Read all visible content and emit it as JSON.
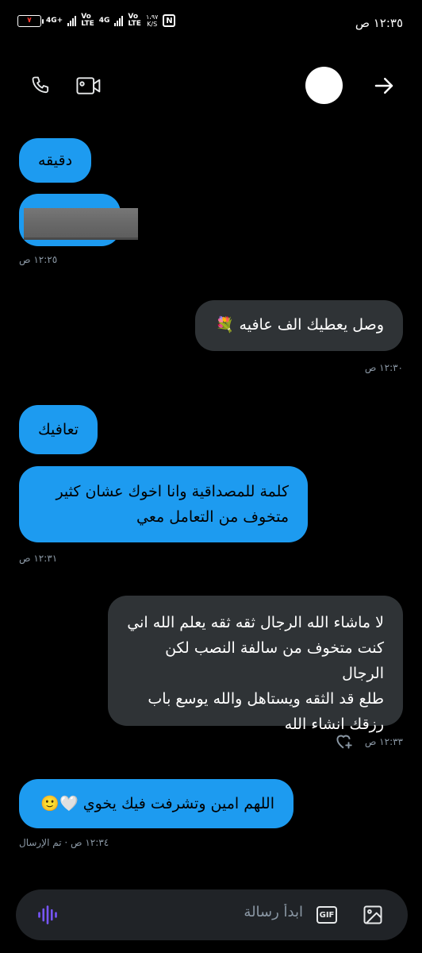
{
  "status_bar": {
    "time": "١٢:٣٥ ص",
    "battery": "٧",
    "net1": "4G+",
    "net1_sub": "",
    "volte1": "Vo\nLTE",
    "net2": "4G",
    "volte2": "Vo\nLTE",
    "speed": "١،٩٧\nK/S",
    "nfc": "N"
  },
  "header": {
    "call_icon": "phone-icon",
    "video_icon": "video-camera-icon",
    "back_icon": "arrow-right-icon"
  },
  "messages": [
    {
      "side": "received",
      "text": "دقيقه"
    },
    {
      "side": "received",
      "text": "",
      "redacted": true
    },
    {
      "meta": "١٢:٢٥ ص"
    },
    {
      "side": "sent",
      "text": "وصل يعطيك الف عافيه 💐"
    },
    {
      "meta": "١٢:٣٠ ص"
    },
    {
      "side": "received",
      "text": "تعافيك"
    },
    {
      "side": "received",
      "line1": "كلمة للمصداقية وانا اخوك عشان كثير",
      "line2": "متخوف من التعامل معي"
    },
    {
      "meta": "١٢:٣١ ص"
    },
    {
      "side": "sent",
      "line1": "لا ماشاء الله الرجال ثقه ثقه يعلم الله اني",
      "line2": "كنت متخوف من سالفة النصب لكن الرجال",
      "line3": "طلع قد الثقه ويستاهل والله يوسع باب",
      "line4": "رزقك انشاء الله"
    },
    {
      "meta": "١٢:٣٣ ص"
    },
    {
      "side": "received",
      "text": "اللهم امين وتشرفت فيك يخوي 🤍🙂"
    },
    {
      "meta": "١٢:٣٤ ص · تم الإرسال"
    }
  ],
  "composer": {
    "placeholder": "ابدأ رسالة",
    "gif_label": "GIF",
    "image_icon": "image-icon",
    "voice_icon": "voice-wave-icon"
  },
  "colors": {
    "received_bubble": "#1d9bf0",
    "sent_bubble": "#2f3336",
    "background": "#000000",
    "voice_accent": "#7856ff"
  }
}
